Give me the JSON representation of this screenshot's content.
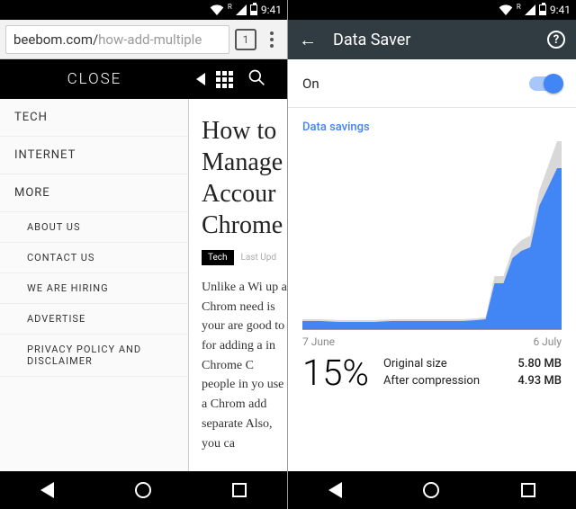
{
  "status": {
    "time": "9:41",
    "network_label": "R"
  },
  "left": {
    "url_host": "beebom.com/",
    "url_path": "how-add-multiple",
    "tab_count": "1",
    "close_label": "CLOSE",
    "drawer": {
      "primary": [
        "TECH",
        "INTERNET",
        "MORE"
      ],
      "sub": [
        "ABOUT US",
        "CONTACT US",
        "WE ARE HIRING",
        "ADVERTISE",
        "PRIVACY POLICY AND DISCLAIMER"
      ]
    },
    "article": {
      "title": "How to Manage Accour Chrome",
      "tag": "Tech",
      "meta": "Last Upd",
      "body": "Unlike a Wi up a Chrom need is your are good to for adding a in Chrome C people in yo use a Chrom add separate Also, you ca"
    }
  },
  "right": {
    "title": "Data Saver",
    "toggle_label": "On",
    "section_label": "Data savings",
    "date_start": "7 June",
    "date_end": "6 July",
    "percent": "15%",
    "rows": [
      {
        "label": "Original size",
        "value": "5.80 MB"
      },
      {
        "label": "After compression",
        "value": "4.93 MB"
      }
    ]
  },
  "chart_data": {
    "type": "area",
    "title": "Data savings",
    "xlabel": "",
    "ylabel": "",
    "x_range": [
      "7 June",
      "6 July"
    ],
    "series": [
      {
        "name": "Original size",
        "color": "#d8d8d8",
        "values_rel": [
          6,
          6,
          6,
          6,
          5,
          5,
          5,
          5,
          6,
          6,
          6,
          6,
          6,
          6,
          6,
          6,
          6,
          6,
          6,
          6,
          6,
          7,
          8,
          30,
          30,
          45,
          52,
          55,
          78,
          100
        ]
      },
      {
        "name": "After compression",
        "color": "#4285f4",
        "values_rel": [
          5,
          5,
          5,
          5,
          4,
          4,
          4,
          4,
          5,
          5,
          5,
          5,
          5,
          5,
          5,
          5,
          5,
          5,
          5,
          5,
          5,
          6,
          7,
          26,
          26,
          40,
          45,
          48,
          68,
          85
        ]
      }
    ],
    "summary": {
      "percent_saved": 15,
      "original_mb": 5.8,
      "compressed_mb": 4.93
    }
  }
}
